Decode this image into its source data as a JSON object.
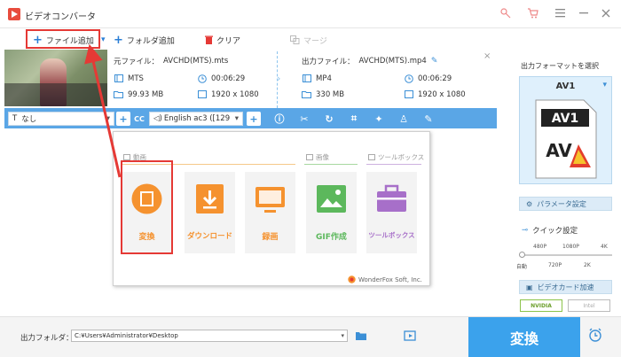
{
  "window": {
    "title": "ビデオコンバータ",
    "icons": [
      "key-icon",
      "cart-icon",
      "menu-icon",
      "minimize-icon",
      "close-icon"
    ]
  },
  "toolbar": {
    "add_file": "ファイル追加",
    "add_folder": "フォルダ追加",
    "clear": "クリア",
    "merge": "マージ"
  },
  "file": {
    "source_label": "元ファイル：",
    "source_name": "AVCHD(MTS).mts",
    "source_format": "MTS",
    "source_duration": "00:06:29",
    "source_size": "99.93 MB",
    "source_resolution": "1920 x 1080",
    "output_label": "出力ファイル：",
    "output_name": "AVCHD(MTS).mp4",
    "output_format": "MP4",
    "output_duration": "00:06:29",
    "output_size": "330 MB",
    "output_resolution": "1920 x 1080"
  },
  "editbar": {
    "subtitle": "なし",
    "audio": "English ac3 ([129"
  },
  "popup": {
    "sections": [
      "動画",
      "画像",
      "ツールボックス"
    ],
    "tiles": [
      {
        "label": "変換",
        "color": "#f5922f"
      },
      {
        "label": "ダウンロード",
        "color": "#f5922f"
      },
      {
        "label": "録画",
        "color": "#f5922f"
      },
      {
        "label": "GIF作成",
        "color": "#5cb85c"
      },
      {
        "label": "ツールボックス",
        "color": "#a76fc9"
      }
    ],
    "brand": "WonderFox Soft, Inc."
  },
  "right_panel": {
    "format_label": "出力フォーマットを選択",
    "format_name": "AV1",
    "params": "パラメータ設定",
    "quick": "クイック設定",
    "quality_top": [
      "480P",
      "1080P",
      "4K"
    ],
    "quality_bottom": [
      "自動",
      "720P",
      "2K"
    ],
    "gpu": "ビデオカード加速",
    "nvidia": "NVIDIA",
    "intel": "Intel"
  },
  "bottom": {
    "folder_label": "出力フォルダ：",
    "folder_path": "C:¥Users¥Administrator¥Desktop",
    "convert": "変換"
  },
  "colors": {
    "accent": "#3ba2ec",
    "highlight": "#e53935",
    "orange": "#f5922f"
  }
}
